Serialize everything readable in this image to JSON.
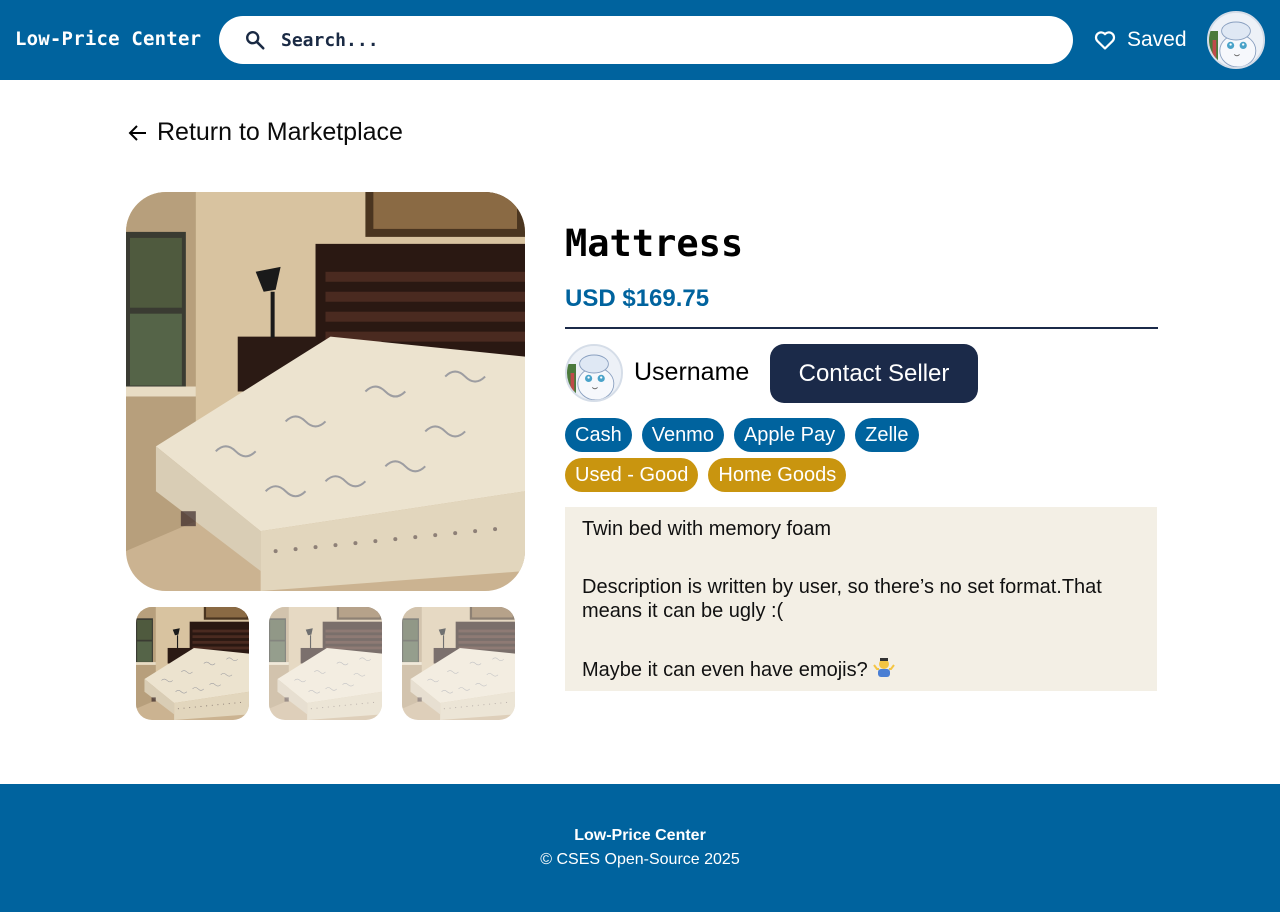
{
  "header": {
    "brand": "Low-Price Center",
    "search_placeholder": "Search...",
    "saved_label": "Saved"
  },
  "back_link": "Return to Marketplace",
  "listing": {
    "title": "Mattress",
    "price": "USD $169.75",
    "seller": {
      "username": "Username",
      "contact_label": "Contact Seller"
    },
    "payment_methods": [
      "Cash",
      "Venmo",
      "Apple Pay",
      "Zelle"
    ],
    "attributes": [
      "Used - Good",
      "Home Goods"
    ],
    "description": [
      "Twin bed with memory foam",
      "Description is written by user, so there’s no set format.That means it can  be ugly :(",
      "Maybe it can even have emojis?"
    ],
    "photo_count": 3
  },
  "footer": {
    "name": "Low-Price Center",
    "copyright": "© CSES Open-Source 2025"
  },
  "colors": {
    "primary": "#00639e",
    "navy": "#1b2a49",
    "tag_gold": "#c9950f",
    "description_bg": "#f3efe5"
  },
  "icons": [
    "search-icon",
    "heart-icon",
    "arrow-left-icon",
    "shrug-emoji-icon"
  ]
}
